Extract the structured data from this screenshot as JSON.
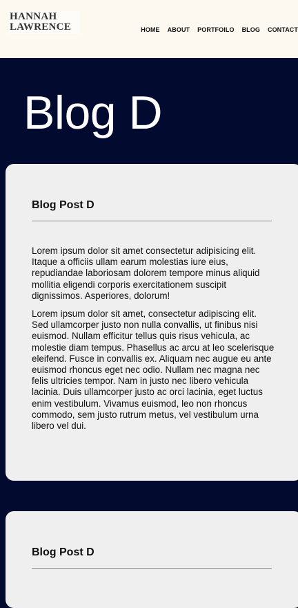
{
  "header": {
    "logo_line1": "HANNAH",
    "logo_line2": "LAWRENCE"
  },
  "nav": {
    "items": [
      "HOME",
      "ABOUT",
      "PORTFOILO",
      "BLOG",
      "CONTACT"
    ]
  },
  "hero": {
    "title": "Blog D"
  },
  "posts": [
    {
      "title": "Blog Post D",
      "paragraphs": [
        "Lorem ipsum dolor sit amet consectetur adipisicing elit. Itaque a officiis ullam earum molestias iure eius, repudiandae laboriosam dolorem tempore minus aliquid mollitia eligendi corporis exercitationem suscipit dignissimos. Asperiores, dolorum!",
        "Lorem ipsum dolor sit amet, consectetur adipiscing elit. Sed ullamcorper justo non nulla convallis, ut finibus nisi euismod. Nullam efficitur tellus quis risus vehicula, ac molestie diam tempus. Phasellus ac arcu at leo scelerisque eleifend. Fusce in convallis ex. Aliquam nec augue eu ante euismod rhoncus eget nec odio. Nullam nec magna nec felis ultricies tempor. Nam in justo nec libero vehicula lacinia. Duis ullamcorper justo ac orci lacinia, eget luctus enim vestibulum. Vivamus euismod, leo non rhoncus commodo, sem justo rutrum metus, vel vestibulum urna libero vel dui."
      ]
    },
    {
      "title": "Blog Post D"
    }
  ],
  "colors": {
    "header_bg": "#fdf8f0",
    "page_bg": "#020a30",
    "card_bg": "#efefef"
  }
}
